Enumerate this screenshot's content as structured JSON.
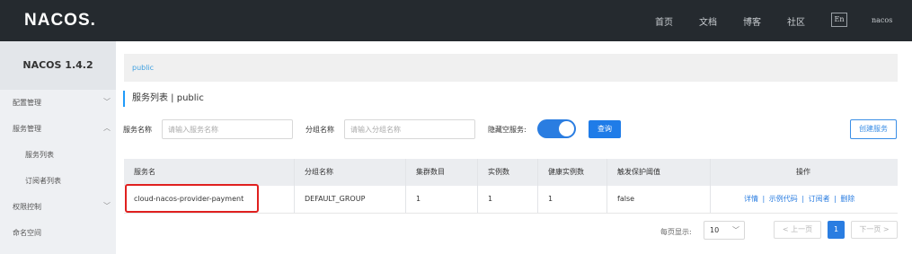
{
  "header": {
    "logo": "NACOS.",
    "nav": [
      "首页",
      "文档",
      "博客",
      "社区"
    ],
    "lang": "En",
    "user": "nacos"
  },
  "sidebar": {
    "version": "NACOS 1.4.2",
    "items": [
      {
        "label": "配置管理",
        "arrow": "﹀"
      },
      {
        "label": "服务管理",
        "arrow": "︿"
      },
      {
        "label": "服务列表"
      },
      {
        "label": "订阅者列表"
      },
      {
        "label": "权限控制",
        "arrow": "﹀"
      },
      {
        "label": "命名空间"
      }
    ]
  },
  "breadcrumb": "public",
  "page": {
    "title": "服务列表  |  public"
  },
  "filters": {
    "service_label": "服务名称",
    "service_placeholder": "请输入服务名称",
    "group_label": "分组名称",
    "group_placeholder": "请输入分组名称",
    "hide_empty_label": "隐藏空服务:",
    "query_label": "查询",
    "create_label": "创建服务"
  },
  "table": {
    "headers": [
      "服务名",
      "分组名称",
      "集群数目",
      "实例数",
      "健康实例数",
      "触发保护阈值",
      "操作"
    ],
    "rows": [
      {
        "name": "cloud-nacos-provider-payment",
        "group": "DEFAULT_GROUP",
        "clusters": "1",
        "instances": "1",
        "healthy": "1",
        "threshold": "false",
        "ops": [
          "详情",
          "示例代码",
          "订阅者",
          "删除"
        ],
        "sep": "|"
      }
    ]
  },
  "pagination": {
    "per_page_label": "每页显示:",
    "per_page": "10",
    "prev": "< 上一页",
    "current": "1",
    "next": "下一页 >"
  },
  "colors": {
    "accent": "#2a7de1",
    "highlight": "#e0201f",
    "topbar": "#252a2f"
  }
}
